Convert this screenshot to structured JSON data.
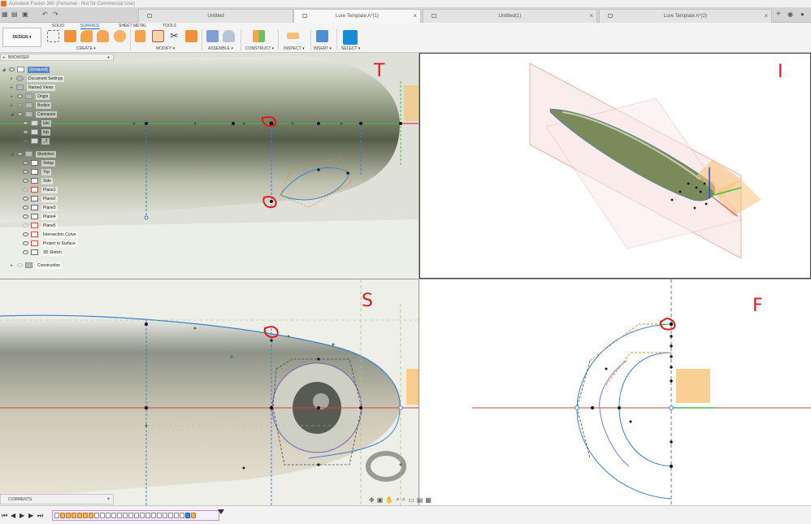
{
  "window": {
    "title": "Autodesk Fusion 360 (Personal - Not for Commercial Use)"
  },
  "tabs": [
    {
      "label": "Untitled",
      "active": false
    },
    {
      "label": "Lure Template A*(1)",
      "active": true
    },
    {
      "label": "Untitled(1)",
      "active": false
    },
    {
      "label": "Lure Template A*(2)",
      "active": false
    }
  ],
  "ribbon": {
    "workspace": "DESIGN",
    "tabs": [
      "SOLID",
      "SURFACE",
      "SHEET METAL",
      "TOOLS"
    ],
    "active_tab": "SURFACE",
    "groups": [
      "CREATE ▾",
      "MODIFY ▾",
      "ASSEMBLE ▾",
      "CONSTRUCT ▾",
      "INSPECT ▾",
      "INSERT ▾",
      "SELECT ▾"
    ]
  },
  "browser": {
    "title": "BROWSER",
    "items": [
      {
        "label": "(Unsaved)"
      },
      {
        "label": "Document Settings"
      },
      {
        "label": "Named Views"
      },
      {
        "label": "Origin"
      },
      {
        "label": "Bodies"
      },
      {
        "label": "Canvases"
      },
      {
        "label": "lato"
      },
      {
        "label": "top"
      },
      {
        "label": "_2"
      },
      {
        "label": "Sketches"
      },
      {
        "label": "Setup"
      },
      {
        "label": "Top"
      },
      {
        "label": "Side"
      },
      {
        "label": "Plane1"
      },
      {
        "label": "Plane2"
      },
      {
        "label": "Plane3"
      },
      {
        "label": "Plane4"
      },
      {
        "label": "Plane5"
      },
      {
        "label": "Intersection Curve"
      },
      {
        "label": "Project to Surface"
      },
      {
        "label": "3D Sketch"
      },
      {
        "label": "Construction"
      }
    ]
  },
  "annotations": {
    "top": "T",
    "iso": "I",
    "side": "S",
    "front": "F"
  },
  "comments": {
    "title": "COMMENTS"
  },
  "colors": {
    "accent": "#1f6fbf",
    "annotation": "#e01a1a",
    "sketch_line": "#3d7fc9",
    "construction_line": "#e08a2b",
    "axis_red": "#e23b3b",
    "axis_green": "#3fbf3f",
    "plane_orange": "#f7c37a"
  }
}
